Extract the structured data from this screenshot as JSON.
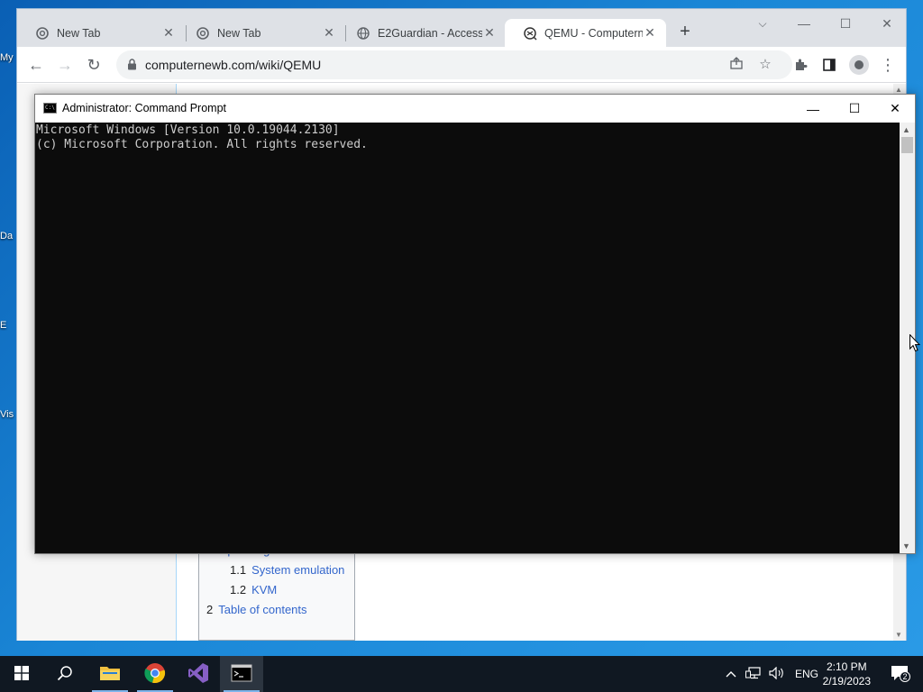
{
  "desktop": {
    "labels": [
      "My",
      "Da",
      "E",
      "Vis"
    ]
  },
  "browser": {
    "tabs": [
      {
        "title": "New Tab",
        "icon": "chrome-icon",
        "active": false
      },
      {
        "title": "New Tab",
        "icon": "chrome-icon",
        "active": false
      },
      {
        "title": "E2Guardian - Access",
        "icon": "globe-icon",
        "active": false
      },
      {
        "title": "QEMU - Computernewb",
        "icon": "qemu-icon",
        "active": true
      }
    ],
    "new_tab_glyph": "+",
    "window_controls": {
      "dropdown": "⌵",
      "minimize": "—",
      "maximize": "☐",
      "close": "✕"
    },
    "toolbar": {
      "back": "←",
      "forward": "→",
      "reload": "↻",
      "url": "computernewb.com/wiki/QEMU"
    }
  },
  "page": {
    "toc": [
      {
        "num": "1",
        "text": "Operating modes",
        "level": 1
      },
      {
        "num": "1.1",
        "text": "System emulation",
        "level": 2
      },
      {
        "num": "1.2",
        "text": "KVM",
        "level": 2
      },
      {
        "num": "2",
        "text": "Table of contents",
        "level": 1
      }
    ]
  },
  "cmd": {
    "title": "Administrator:  Command Prompt",
    "lines": [
      "Microsoft Windows [Version 10.0.19044.2130]",
      "(c) Microsoft Corporation. All rights reserved."
    ],
    "controls": {
      "minimize": "—",
      "maximize": "☐",
      "close": "✕"
    }
  },
  "taskbar": {
    "apps": [
      {
        "name": "start",
        "icon": "windows-icon"
      },
      {
        "name": "search",
        "icon": "search-icon"
      },
      {
        "name": "file-explorer",
        "icon": "folder-icon"
      },
      {
        "name": "chrome",
        "icon": "chrome-icon"
      },
      {
        "name": "visual-studio",
        "icon": "visual-studio-icon"
      },
      {
        "name": "command-prompt",
        "icon": "cmd-icon",
        "active": true
      }
    ],
    "tray": {
      "language": "ENG",
      "time": "2:10 PM",
      "date": "2/19/2023",
      "notification_count": "2"
    }
  },
  "colors": {
    "desktop": "#1a86d6",
    "taskbar": "#101822",
    "console_bg": "#0c0c0c",
    "console_fg": "#cccccc",
    "link": "#3366cc"
  }
}
